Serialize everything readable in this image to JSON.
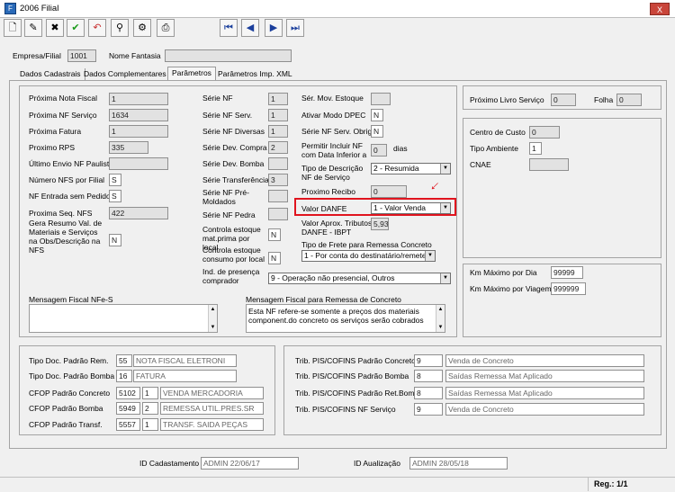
{
  "window": {
    "title": "2006 Filial",
    "close_label": "X"
  },
  "header": {
    "empresa_label": "Empresa/Filial",
    "empresa_value": "1001",
    "fantasia_label": "Nome Fantasia",
    "fantasia_value": ""
  },
  "tabs": [
    "Dados Cadastrais",
    "Dados Complementares",
    "Parâmetros",
    "Parâmetros Imp. XML"
  ],
  "left": {
    "proxima_nf_label": "Próxima Nota Fiscal",
    "proxima_nf_value": "1",
    "proxima_nf_servico_label": "Próxima NF Serviço",
    "proxima_nf_servico_value": "1634",
    "proxima_fatura_label": "Próxima Fatura",
    "proxima_fatura_value": "1",
    "proximo_rps_label": "Proximo RPS",
    "proximo_rps_value": "335",
    "ultimo_envio_label": "Último Envio NF Paulista",
    "ultimo_envio_value": "",
    "numero_nfs_label": "Número NFS por Filial",
    "numero_nfs_value": "S",
    "nf_entrada_label": "NF Entrada sem Pedido",
    "nf_entrada_value": "S",
    "proxima_seq_label": "Proxima Seq. NFS",
    "proxima_seq_value": "422",
    "gera_resumo_label": "Gera Resumo Val. de Materiais e Serviços na Obs/Descrição na NFS",
    "gera_resumo_value": "N"
  },
  "series": {
    "serie_nf_label": "Série NF",
    "serie_nf_value": "1",
    "serie_nf_serv_label": "Série NF Serv.",
    "serie_nf_serv_value": "1",
    "serie_nf_diversas_label": "Série NF Diversas",
    "serie_nf_diversas_value": "1",
    "serie_dev_compra_label": "Série Dev. Compra",
    "serie_dev_compra_value": "2",
    "serie_dev_bomba_label": "Série Dev. Bomba",
    "serie_dev_bomba_value": "",
    "serie_transferencia_label": "Série Transferência",
    "serie_transferencia_value": "3",
    "serie_premoldados_label": "Série NF Pré-Moldados",
    "serie_premoldados_value": "",
    "serie_pedra_label": "Série NF Pedra",
    "serie_pedra_value": "",
    "controla_mat_label": "Controla estoque mat.prima por local",
    "controla_mat_value": "N",
    "controla_consumo_label": "Controla estoque consumo por local",
    "controla_consumo_value": "N",
    "ind_presenca_label": "Ind. de presença comprador",
    "ind_presenca_value": "9 - Operação não presencial, Outros"
  },
  "mid": {
    "ser_mov_label": "Sér. Mov. Estoque",
    "ser_mov_value": "",
    "ativar_dpec_label": "Ativar Modo DPEC",
    "ativar_dpec_value": "N",
    "serie_obrig_label": "Série NF Serv. Obrig.",
    "serie_obrig_value": "N",
    "permitir_label": "Permitir Incluir NF com Data Inferior a",
    "permitir_value": "0",
    "permitir_unit": "dias",
    "tipo_desc_label": "Tipo de Descrição NF de Serviço",
    "tipo_desc_value": "2 - Resumida",
    "proximo_recibo_label": "Proximo Recibo",
    "proximo_recibo_value": "0",
    "valor_danfe_label": "Valor DANFE",
    "valor_danfe_value": "1 - Valor Venda",
    "valor_aprox_label": "Valor Aprox. Tributos DANFE - IBPT",
    "valor_aprox_value": "5,93",
    "tipo_frete_label": "Tipo de Frete para Remessa Concreto",
    "tipo_frete_value": "1 - Por conta do destinatário/remetente"
  },
  "right": {
    "proximo_livro_label": "Próximo Livro Serviço",
    "proximo_livro_value": "0",
    "folha_label": "Folha",
    "folha_value": "0",
    "centro_custo_label": "Centro de Custo",
    "centro_custo_value": "0",
    "tipo_ambiente_label": "Tipo Ambiente",
    "tipo_ambiente_value": "1",
    "cnae_label": "CNAE",
    "cnae_value": "",
    "km_dia_label": "Km Máximo por Dia",
    "km_dia_value": "99999",
    "km_viagem_label": "Km Máximo por Viagem",
    "km_viagem_value": "999999"
  },
  "messages": {
    "nfes_label": "Mensagem Fiscal NFe-S",
    "nfes_value": "",
    "remessa_label": "Mensagem Fiscal para Remessa de Concreto",
    "remessa_value": "Esta NF refere-se somente a preços dos materiais component.do concreto os serviços serão cobrados"
  },
  "bottom_left": {
    "tipo_rem_label": "Tipo Doc. Padrão Rem.",
    "tipo_rem_code": "55",
    "tipo_rem_desc": "NOTA FISCAL ELETRONI",
    "tipo_bomba_label": "Tipo Doc. Padrão Bomba",
    "tipo_bomba_code": "16",
    "tipo_bomba_desc": "FATURA",
    "cfop_concreto_label": "CFOP Padrão Concreto",
    "cfop_concreto_code": "5102",
    "cfop_concreto_n": "1",
    "cfop_concreto_desc": "VENDA MERCADORIA",
    "cfop_bomba_label": "CFOP Padrão Bomba",
    "cfop_bomba_code": "5949",
    "cfop_bomba_n": "2",
    "cfop_bomba_desc": "REMESSA UTIL.PRES.SR",
    "cfop_transf_label": "CFOP Padrão Transf.",
    "cfop_transf_code": "5557",
    "cfop_transf_n": "1",
    "cfop_transf_desc": "TRANSF. SAIDA PEÇAS"
  },
  "bottom_right": {
    "trib_concreto_label": "Trib. PIS/COFINS Padrão Concreto",
    "trib_concreto_code": "9",
    "trib_concreto_desc": "Venda de Concreto",
    "trib_bomba_label": "Trib. PIS/COFINS Padrão Bomba",
    "trib_bomba_code": "8",
    "trib_bomba_desc": "Saídas Remessa Mat Aplicado",
    "trib_retbom_label": "Trib. PIS/COFINS Padrão Ret.Bom",
    "trib_retbom_code": "8",
    "trib_retbom_desc": "Saídas Remessa Mat Aplicado",
    "trib_servico_label": "Trib. PIS/COFINS NF Serviço",
    "trib_servico_code": "9",
    "trib_servico_desc": "Venda de Concreto"
  },
  "footer": {
    "cadastro_label": "ID Cadastamento",
    "cadastro_value": "ADMIN 22/06/17",
    "atualizacao_label": "ID Aualização",
    "atualizacao_value": "ADMIN 28/05/18",
    "reg": "Reg.: 1/1"
  },
  "colors": {
    "highlight": "#e0141e",
    "close": "#c9453a"
  }
}
